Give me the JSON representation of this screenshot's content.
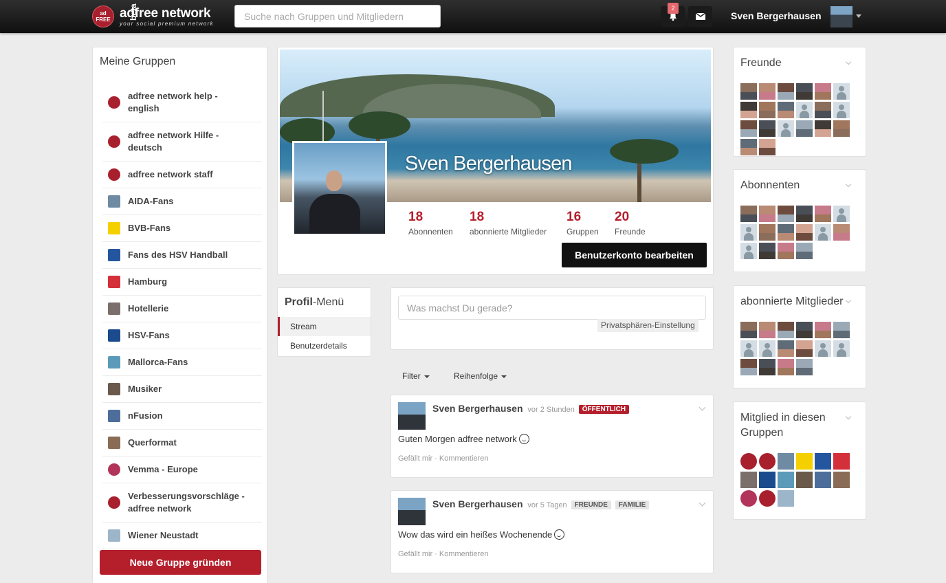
{
  "header": {
    "logo_badge": "ad FREE",
    "logo_title": "adfree network",
    "logo_subtitle": "your social premium network",
    "logo_beta": "beta",
    "search_placeholder": "Suche nach Gruppen und Mitgliedern",
    "notification_count": "2",
    "user_name": "Sven Bergerhausen"
  },
  "groups": {
    "title": "Meine Gruppen",
    "items": [
      {
        "label": "adfree network help - english",
        "icon": "adfree-logo-icon",
        "color": "#a8202d"
      },
      {
        "label": "adfree network Hilfe - deutsch",
        "icon": "adfree-logo-icon",
        "color": "#a8202d"
      },
      {
        "label": "adfree network staff",
        "icon": "adfree-logo-icon",
        "color": "#a8202d"
      },
      {
        "label": "AIDA-Fans",
        "icon": "ship-icon",
        "color": "#6f8aa3"
      },
      {
        "label": "BVB-Fans",
        "icon": "bvb-crest-icon",
        "color": "#f4d000"
      },
      {
        "label": "Fans des HSV Handball",
        "icon": "hsv-handball-icon",
        "color": "#2456a0"
      },
      {
        "label": "Hamburg",
        "icon": "hamburg-crest-icon",
        "color": "#d3303a"
      },
      {
        "label": "Hotellerie",
        "icon": "hotel-icon",
        "color": "#7a6f6a"
      },
      {
        "label": "HSV-Fans",
        "icon": "hsv-diamond-icon",
        "color": "#1b4b8c"
      },
      {
        "label": "Mallorca-Fans",
        "icon": "beach-icon",
        "color": "#5b9ab8"
      },
      {
        "label": "Musiker",
        "icon": "guitar-icon",
        "color": "#6b5a4b"
      },
      {
        "label": "nFusion",
        "icon": "wings-icon",
        "color": "#4d6e9a"
      },
      {
        "label": "Querformat",
        "icon": "camera-icon",
        "color": "#8a6c56"
      },
      {
        "label": "Vemma - Europe",
        "icon": "vemma-icon",
        "color": "#b2345a"
      },
      {
        "label": "Verbesserungsvorschläge - adfree network",
        "icon": "adfree-logo-icon",
        "color": "#a8202d"
      },
      {
        "label": "Wiener Neustadt",
        "icon": "book-icon",
        "color": "#9cb5c9"
      }
    ],
    "new_group_label": "Neue Gruppe gründen"
  },
  "profile": {
    "name": "Sven Bergerhausen",
    "stats": [
      {
        "value": "18",
        "label": "Abonnenten"
      },
      {
        "value": "18",
        "label": "abonnierte Mitglieder"
      },
      {
        "value": "16",
        "label": "Gruppen"
      },
      {
        "value": "20",
        "label": "Freunde"
      }
    ],
    "edit_label": "Benutzerkonto bearbeiten"
  },
  "profile_menu": {
    "title_bold": "Profil",
    "title_rest": "-Menü",
    "items": [
      "Stream",
      "Benutzerdetails"
    ]
  },
  "composer": {
    "placeholder": "Was machst Du gerade?",
    "privacy_label": "Privatsphären-Einstellung"
  },
  "feed_controls": {
    "filter_label": "Filter",
    "order_label": "Reihenfolge"
  },
  "posts": [
    {
      "author": "Sven Bergerhausen",
      "time": "vor 2 Stunden",
      "tags": [
        "ÖFFENTLICH"
      ],
      "text": "Guten Morgen adfree network",
      "like_label": "Gefällt mir",
      "comment_label": "Kommentieren"
    },
    {
      "author": "Sven Bergerhausen",
      "time": "vor 5 Tagen",
      "tags": [
        "FREUNDE",
        "FAMILIE"
      ],
      "text": "Wow das wird ein heißes Wochenende",
      "like_label": "Gefällt mir",
      "comment_label": "Kommentieren"
    }
  ],
  "sidebar": {
    "friends_title": "Freunde",
    "subscribers_title": "Abonnenten",
    "subscribed_title": "abonnierte Mitglieder",
    "member_groups_title": "Mitglied in diesen Gruppen"
  },
  "colors": {
    "accent": "#b51f2c",
    "topbar": "#1a1a1a",
    "background": "#ececec"
  }
}
